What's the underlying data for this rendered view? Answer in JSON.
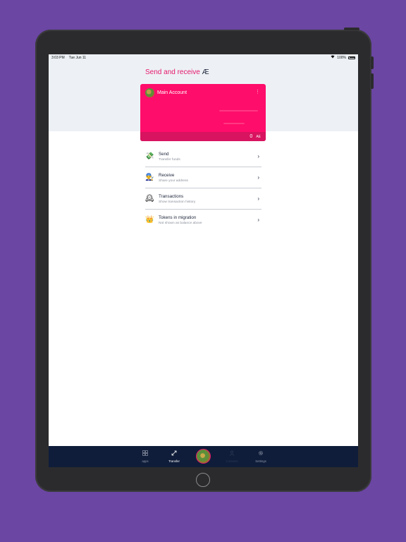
{
  "status_bar": {
    "time": "3:03 PM",
    "date": "Tue Jun 11",
    "battery": "100%"
  },
  "header": {
    "title": "Send and receive ",
    "currency_symbol": "Æ"
  },
  "account_card": {
    "name": "Main Account",
    "balance": "0",
    "unit": "AE",
    "menu_icon": "kebab-icon",
    "color": "#ff0d6a"
  },
  "menu": [
    {
      "title": "Send",
      "subtitle": "Transfer funds",
      "emoji": "💸"
    },
    {
      "title": "Receive",
      "subtitle": "Share your address",
      "emoji": "👨‍🔧"
    },
    {
      "title": "Transactions",
      "subtitle": "Show transaction history",
      "emoji": "🕰"
    },
    {
      "title": "Tokens in migration",
      "subtitle": "Not shown as balance above",
      "emoji": "👑"
    }
  ],
  "tabbar": {
    "apps": "apps",
    "transfer": "Transfer",
    "contacts": "Contacts",
    "settings": "Settings"
  },
  "colors": {
    "accent": "#e6186d",
    "navbar": "#0f1d3a",
    "background": "#6b46a3"
  }
}
